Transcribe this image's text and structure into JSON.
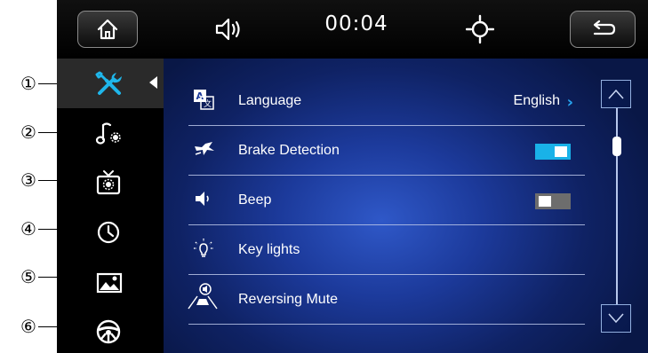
{
  "header": {
    "home_icon": "home-icon",
    "volume_icon": "volume-icon",
    "clock": "00:04",
    "brightness_icon": "brightness-icon",
    "back_icon": "back-arrow-icon"
  },
  "sidebar": {
    "items": [
      {
        "id": "general-settings",
        "icon": "tools-icon",
        "active": true
      },
      {
        "id": "sound-settings",
        "icon": "music-settings-icon",
        "active": false
      },
      {
        "id": "display-settings",
        "icon": "tv-settings-icon",
        "active": false
      },
      {
        "id": "time-settings",
        "icon": "clock-icon",
        "active": false
      },
      {
        "id": "wallpaper-settings",
        "icon": "picture-icon",
        "active": false
      },
      {
        "id": "steering-settings",
        "icon": "steering-wheel-icon",
        "active": false
      }
    ]
  },
  "callouts": [
    "①",
    "②",
    "③",
    "④",
    "⑤",
    "⑥"
  ],
  "settings": {
    "rows": [
      {
        "label": "Language",
        "icon": "language-icon",
        "value": "English",
        "control": "link"
      },
      {
        "label": "Brake Detection",
        "icon": "brake-detection-icon",
        "control": "toggle",
        "state": "on"
      },
      {
        "label": "Beep",
        "icon": "beep-icon",
        "control": "toggle",
        "state": "off"
      },
      {
        "label": "Key lights",
        "icon": "key-lights-icon",
        "control": "none"
      },
      {
        "label": "Reversing Mute",
        "icon": "reversing-mute-icon",
        "control": "none"
      }
    ]
  },
  "colors": {
    "accent": "#19b2e8",
    "background": "#1c3a9b",
    "toggle_off": "#6d6d6d"
  },
  "scrollbar": {
    "position": 0.15
  }
}
